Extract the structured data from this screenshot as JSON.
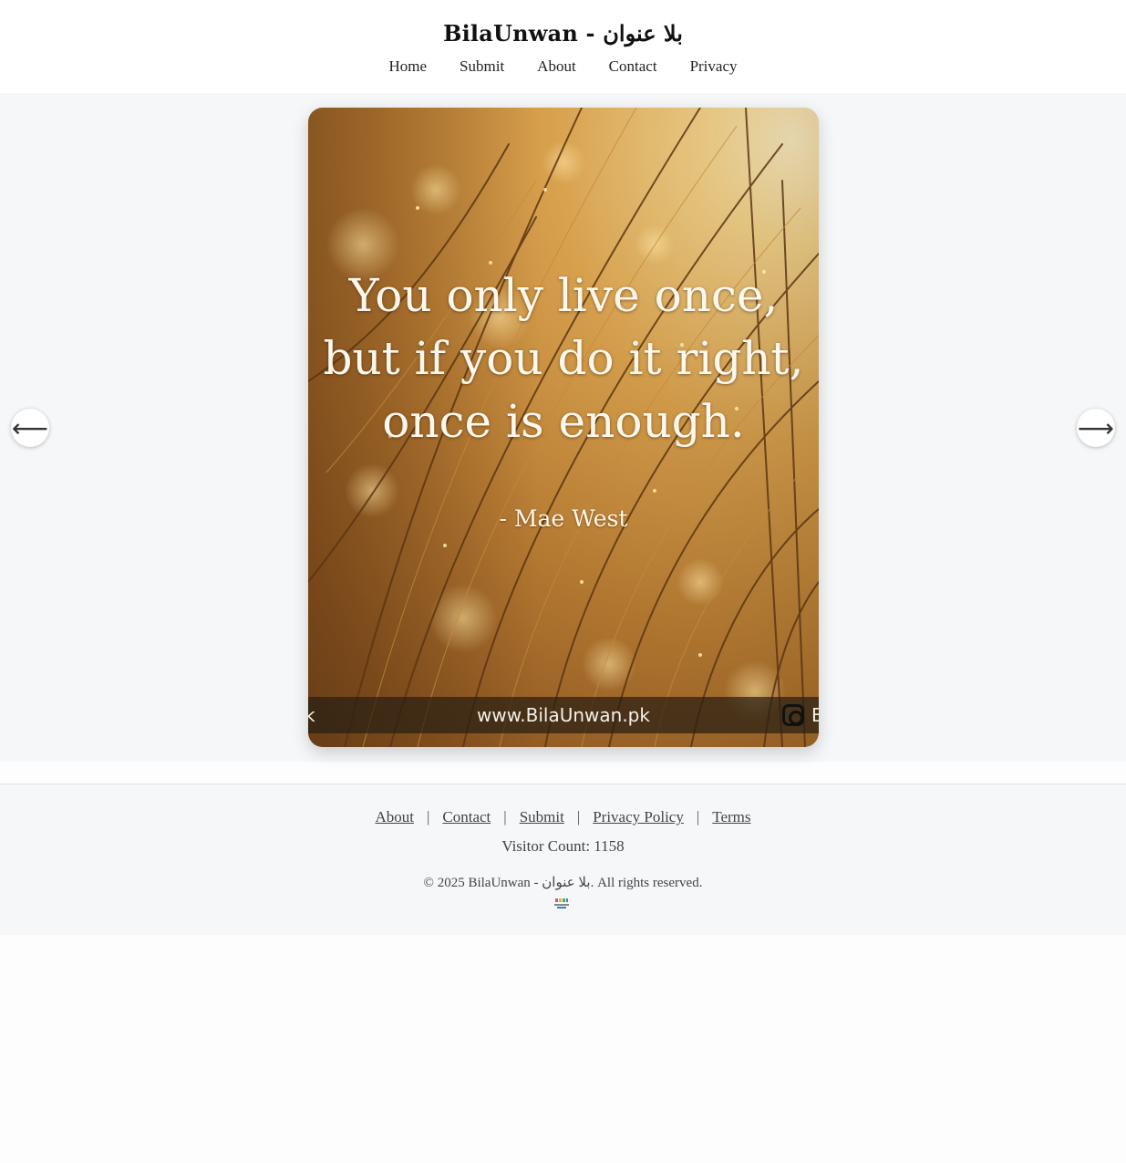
{
  "header": {
    "title": "BilaUnwan - بلا عنوان",
    "nav": [
      "Home",
      "Submit",
      "About",
      "Contact",
      "Privacy"
    ]
  },
  "slide": {
    "quote_lines": [
      "You only live once,",
      "but if you do it right,",
      "once is enough."
    ],
    "author": "- Mae West",
    "watermark_url": "www.BilaUnwan.pk",
    "watermark_left": "k",
    "watermark_right": "B",
    "watermark_icon": "instagram-icon"
  },
  "slider": {
    "prev_icon": "⟵",
    "next_icon": "⟶"
  },
  "footer": {
    "links": [
      "About",
      "Contact",
      "Submit",
      "Privacy Policy",
      "Terms"
    ],
    "separator": "|",
    "visitor_count": "Visitor Count: 1158",
    "copyright": "© 2025 BilaUnwan - بلا عنوان. All rights reserved."
  },
  "colors": {
    "page_bg": "#fdfdfd",
    "section_bg": "#f5f7f9",
    "header_bg": "#ffffff",
    "quote_text": "#fdf8ee"
  }
}
